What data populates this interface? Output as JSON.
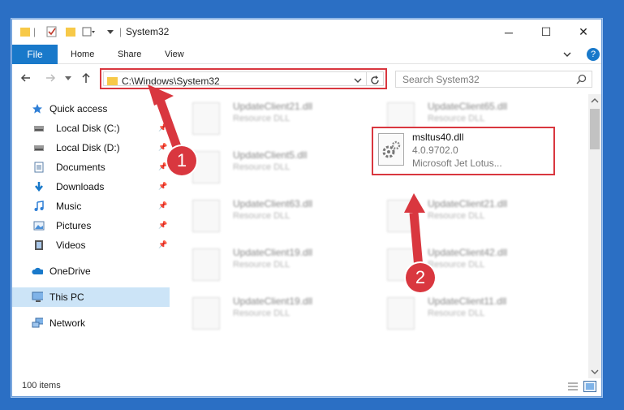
{
  "window": {
    "title": "System32"
  },
  "controls": {
    "minimize": "─",
    "maximize": "☐",
    "close": "✕"
  },
  "ribbon": {
    "file": "File",
    "tabs": [
      "Home",
      "Share",
      "View"
    ],
    "help": "?"
  },
  "nav": {
    "address": "C:\\Windows\\System32",
    "search_placeholder": "Search System32"
  },
  "sidebar": {
    "items": [
      {
        "label": "Quick access",
        "icon": "star-icon"
      },
      {
        "label": "Local Disk (C:)",
        "icon": "drive-icon",
        "pinned": true
      },
      {
        "label": "Local Disk (D:)",
        "icon": "drive-icon",
        "pinned": true
      },
      {
        "label": "Documents",
        "icon": "document-icon",
        "pinned": true
      },
      {
        "label": "Downloads",
        "icon": "download-icon",
        "pinned": true
      },
      {
        "label": "Music",
        "icon": "music-icon",
        "pinned": true
      },
      {
        "label": "Pictures",
        "icon": "pictures-icon",
        "pinned": true
      },
      {
        "label": "Videos",
        "icon": "video-icon",
        "pinned": true
      },
      {
        "label": "OneDrive",
        "icon": "cloud-icon"
      },
      {
        "label": "This PC",
        "icon": "computer-icon",
        "selected": true
      },
      {
        "label": "Network",
        "icon": "network-icon"
      }
    ]
  },
  "files": [
    {
      "name": "UpdateClient21.dll",
      "desc": "Resource DLL"
    },
    {
      "name": "UpdateClient65.dll",
      "desc": "Resource DLL"
    },
    {
      "name": "UpdateClient5.dll",
      "desc": "Resource DLL"
    },
    {
      "name": "UpdateClient63.dll",
      "desc": "Resource DLL"
    },
    {
      "name": "UpdateClient21.dll",
      "desc": "Resource DLL"
    },
    {
      "name": "UpdateClient19.dll",
      "desc": "Resource DLL"
    },
    {
      "name": "UpdateClient42.dll",
      "desc": "Resource DLL"
    },
    {
      "name": "UpdateClient19.dll",
      "desc": "Resource DLL"
    },
    {
      "name": "UpdateClient11.dll",
      "desc": "Resource DLL"
    }
  ],
  "selected_file": {
    "name": "msltus40.dll",
    "version": "4.0.9702.0",
    "desc": "Microsoft Jet Lotus..."
  },
  "status": {
    "items": "100 items"
  },
  "annotations": {
    "step1": "1",
    "step2": "2"
  },
  "colors": {
    "accent": "#1979ca",
    "highlight": "#d9373f",
    "selected": "#cce4f7"
  }
}
